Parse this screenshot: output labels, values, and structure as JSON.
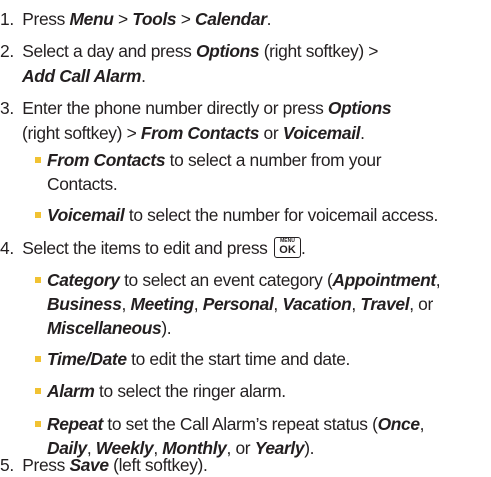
{
  "steps": [
    {
      "num": "1.",
      "parts": [
        "Press ",
        "Menu",
        " > ",
        "Tools",
        " > ",
        "Calendar",
        "."
      ]
    },
    {
      "num": "2.",
      "line1": [
        "Select a day and press ",
        "Options",
        " (right softkey) >"
      ],
      "line2": [
        "Add Call Alarm",
        "."
      ]
    },
    {
      "num": "3.",
      "line1": [
        "Enter the phone number directly or press ",
        "Options"
      ],
      "line2": [
        "(right softkey) > ",
        "From Contacts",
        " or ",
        "Voicemail",
        "."
      ]
    },
    {
      "num": "4.",
      "parts": [
        "Select the items to edit and press ",
        "."
      ]
    },
    {
      "num": "5.",
      "parts": [
        "Press ",
        "Save",
        " (left softkey)."
      ]
    }
  ],
  "step3_bullets": [
    {
      "term": "From Contacts",
      "line1": " to select a number from your",
      "line2": "Contacts."
    },
    {
      "term": "Voicemail",
      "line1": " to select the number for voicemail access."
    }
  ],
  "step4_bullets": [
    {
      "term": "Category",
      "line1": [
        " to select an event category (",
        "Appointment",
        ","
      ],
      "line2": [
        "Business",
        ", ",
        "Meeting",
        ", ",
        "Personal",
        ", ",
        "Vacation",
        ", ",
        "Travel",
        ", or"
      ],
      "line3": [
        "Miscellaneous",
        ")."
      ]
    },
    {
      "term": "Time/Date",
      "line1": [
        " to edit the start time and date."
      ]
    },
    {
      "term": "Alarm",
      "line1": [
        " to select the ringer alarm."
      ]
    },
    {
      "term": "Repeat",
      "line1": [
        " to set the Call Alarm’s repeat status (",
        "Once",
        ","
      ],
      "line2": [
        "Daily",
        ", ",
        "Weekly",
        ", ",
        "Monthly",
        ", or ",
        "Yearly",
        ")."
      ]
    }
  ],
  "okkey": {
    "top": "MENU",
    "main": "OK"
  },
  "colors": {
    "text": "#231f20",
    "bullet": "#f1c232"
  },
  "icons": {
    "bullet": "square-bullet-icon",
    "okkey": "menu-ok-key-icon"
  }
}
